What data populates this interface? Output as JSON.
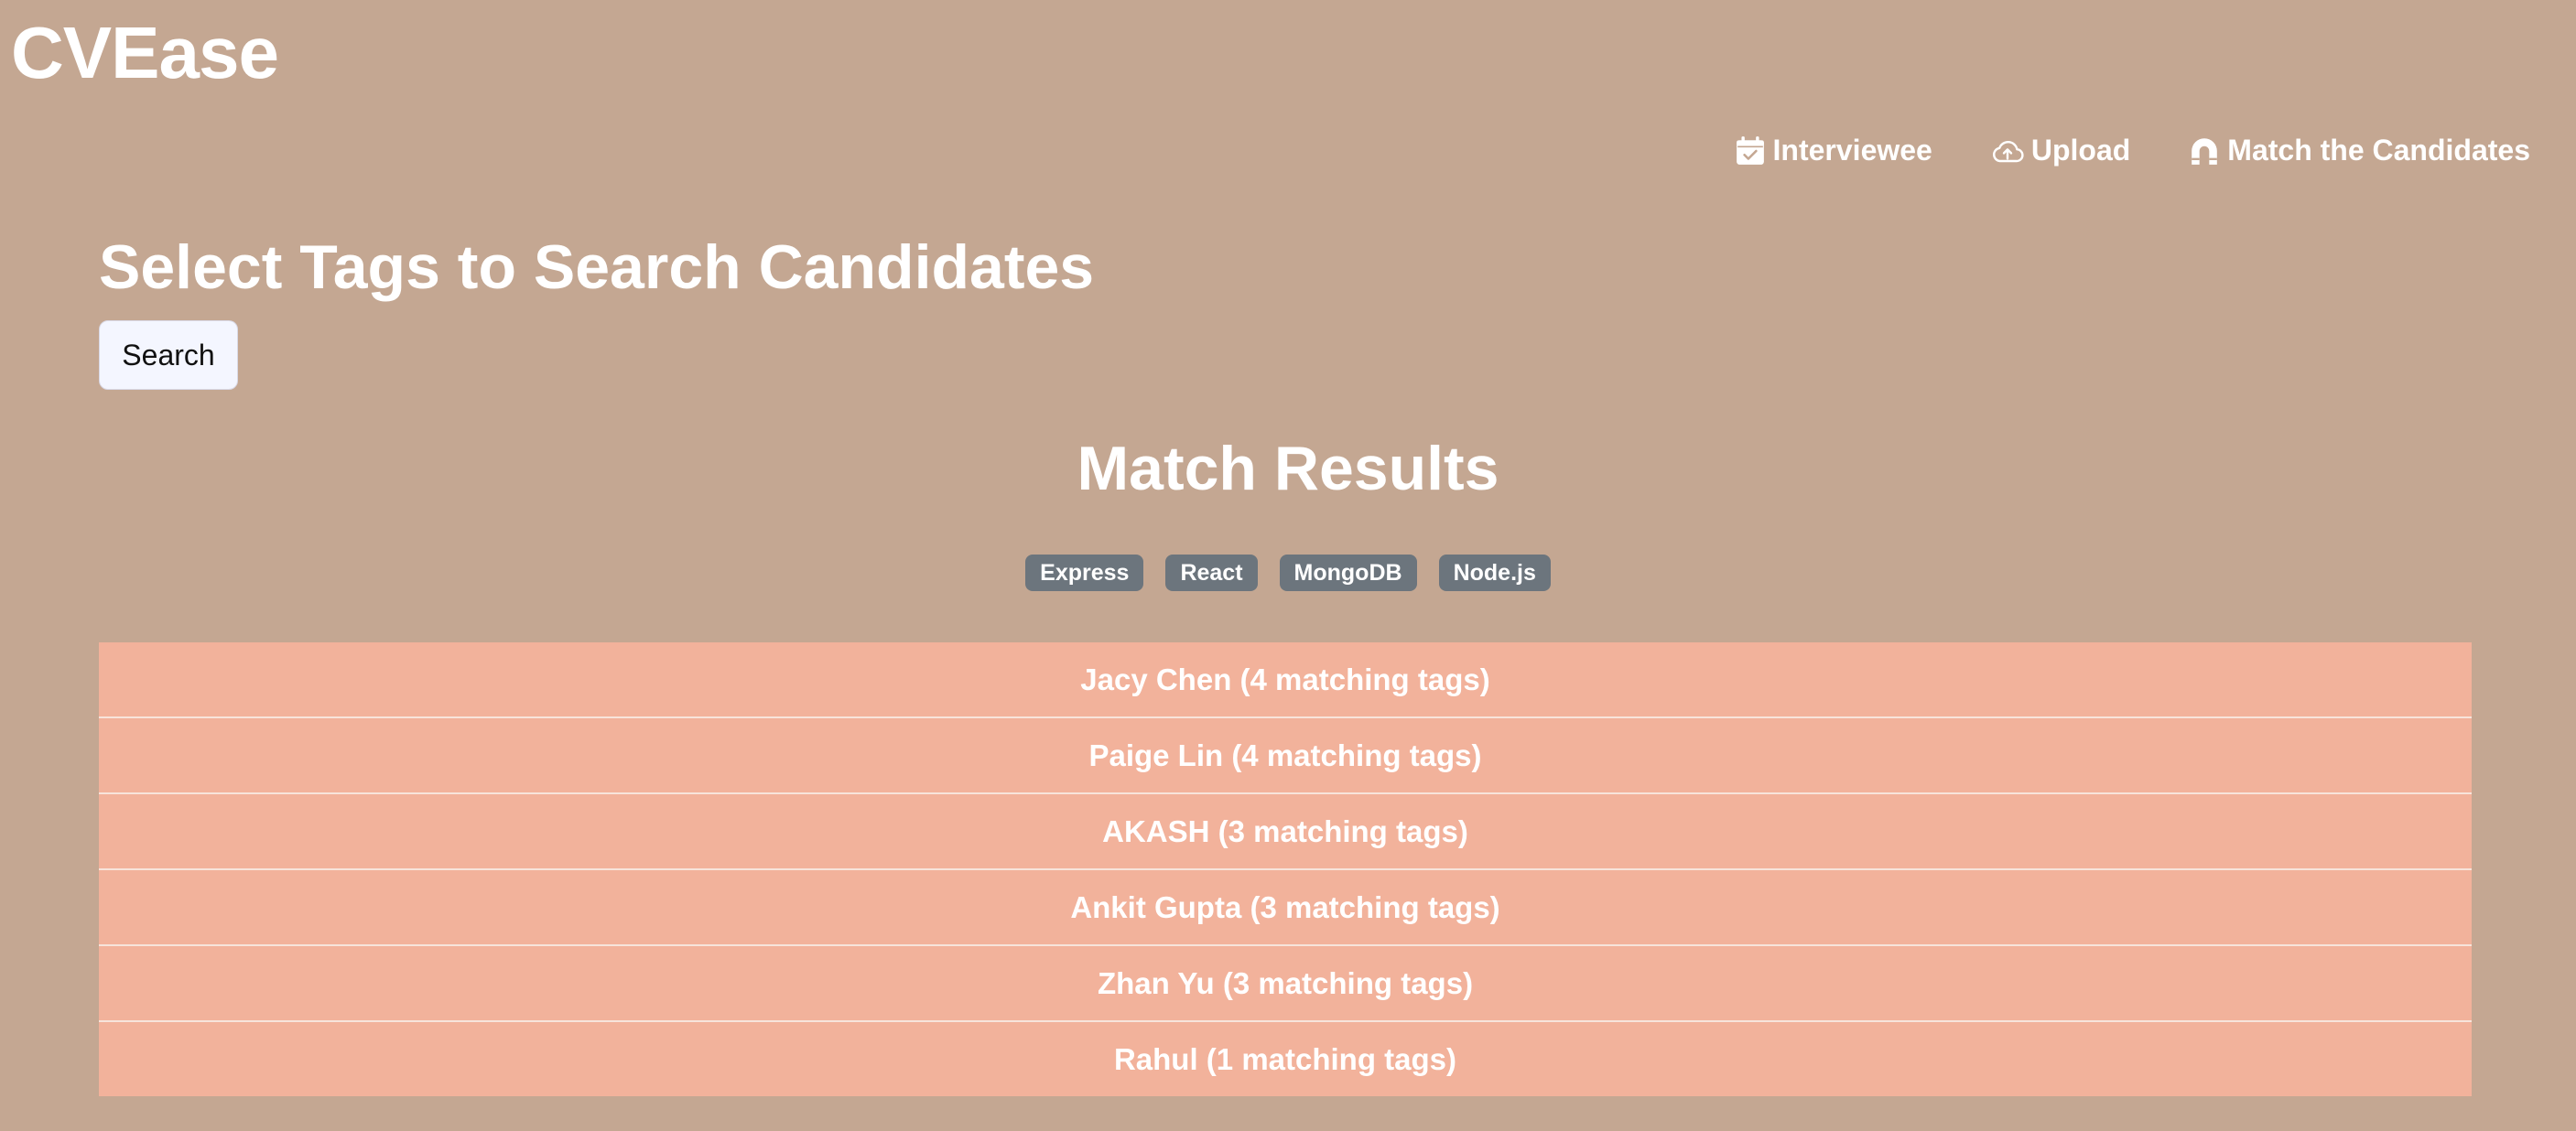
{
  "app": {
    "brand": "CVEase"
  },
  "nav": {
    "items": [
      {
        "label": "Interviewee",
        "icon": "calendar-check-icon"
      },
      {
        "label": "Upload",
        "icon": "cloud-upload-icon"
      },
      {
        "label": "Match the Candidates",
        "icon": "magnet-icon"
      }
    ]
  },
  "search": {
    "title": "Select Tags to Search Candidates",
    "button_label": "Search"
  },
  "results": {
    "title": "Match Results",
    "tags": [
      "Express",
      "React",
      "MongoDB",
      "Node.js"
    ],
    "candidates": [
      "Jacy Chen (4 matching tags)",
      "Paige Lin (4 matching tags)",
      "AKASH (3 matching tags)",
      "Ankit Gupta (3 matching tags)",
      "Zhan Yu (3 matching tags)",
      "Rahul (1 matching tags)"
    ]
  },
  "colors": {
    "background": "#c4a792",
    "result_row": "#f2b29b",
    "tag_badge": "#6c757d",
    "text": "#ffffff"
  }
}
